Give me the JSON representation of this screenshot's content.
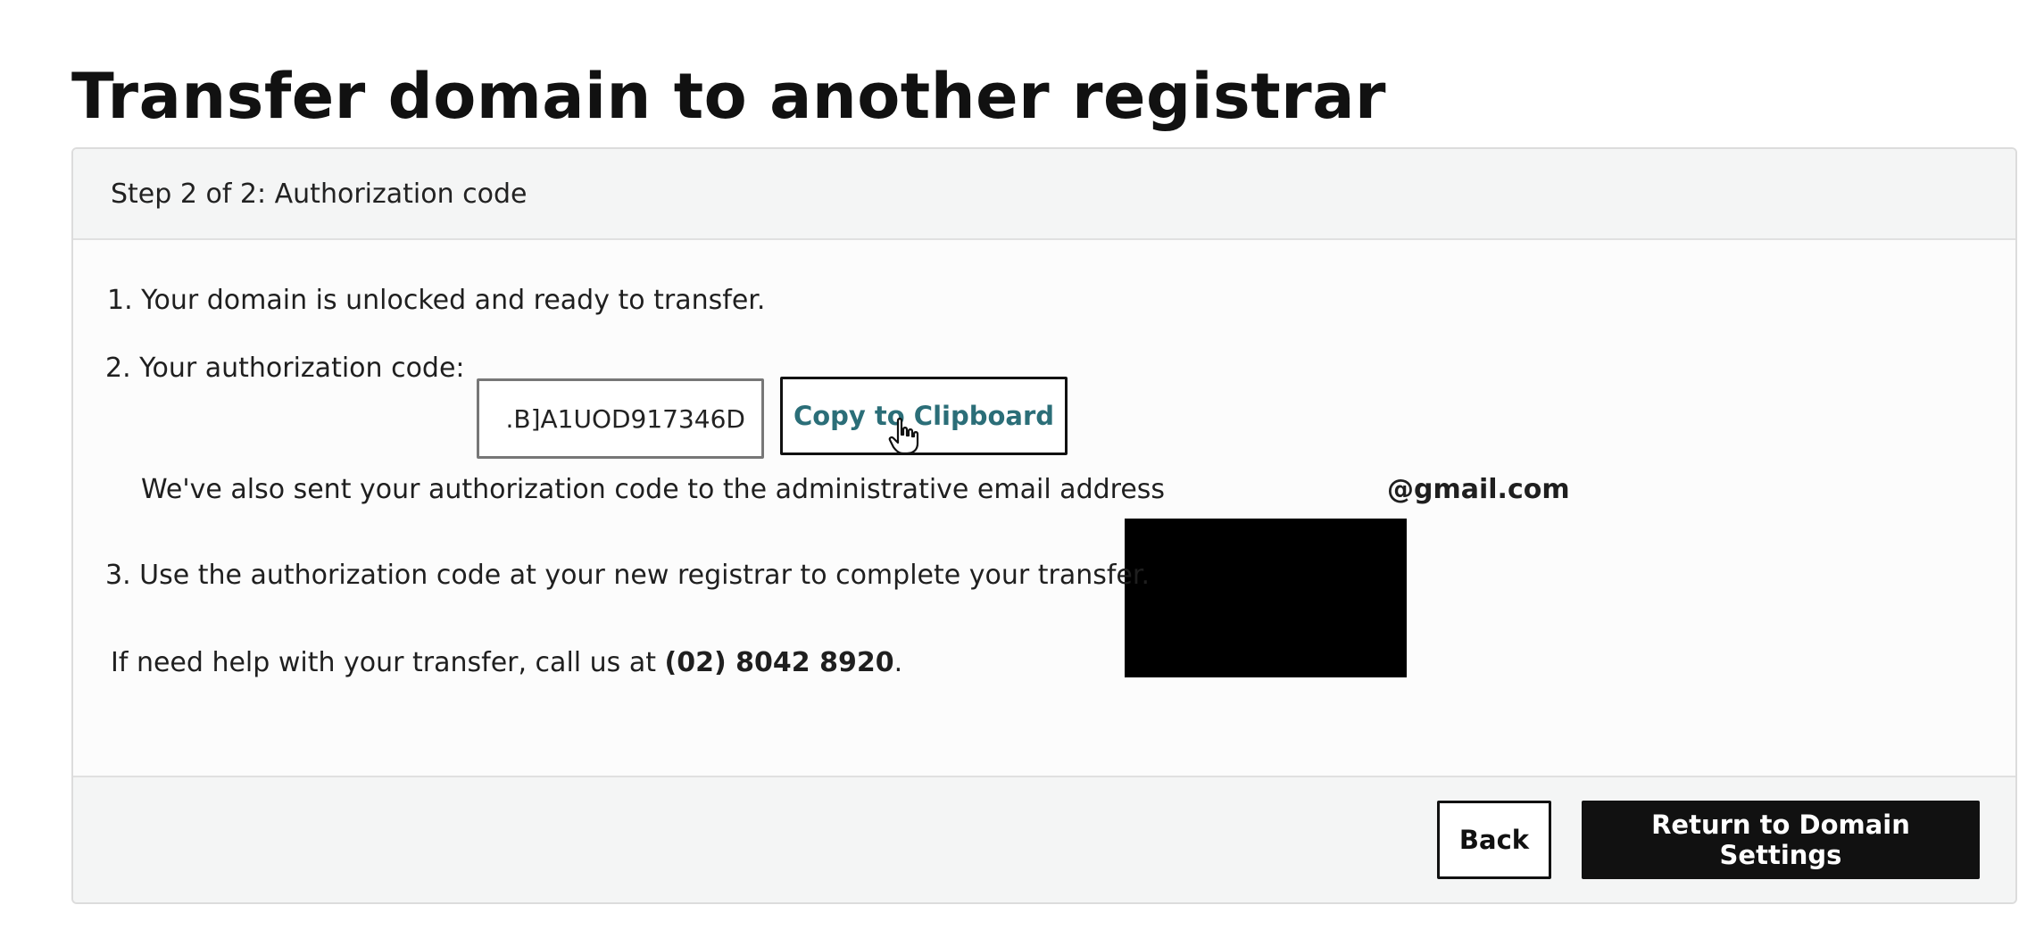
{
  "page": {
    "title": "Transfer domain to another registrar"
  },
  "step": {
    "header": "Step 2 of 2: Authorization code"
  },
  "steps": {
    "item1": "1. Your domain is unlocked and ready to transfer.",
    "item2_label": "2. Your authorization code:",
    "auth_code_value": ".B]A1UOD917346D",
    "copy_button_label": "Copy to Clipboard",
    "email_note": "We've also sent your authorization code to the administrative email address",
    "email_suffix": "@gmail.com",
    "item3": "3. Use the authorization code at your new registrar to complete your transfer."
  },
  "help": {
    "text_prefix": "If need help with your transfer, call us at ",
    "phone": "(02) 8042 8920",
    "text_suffix": "."
  },
  "footer": {
    "back_label": "Back",
    "primary_label": "Return to Domain Settings"
  },
  "colors": {
    "accent_link": "#2b6e78",
    "primary_button": "#111111",
    "header_background": "#f4f5f5"
  },
  "icons": {
    "cursor": "hand-pointer-icon"
  }
}
